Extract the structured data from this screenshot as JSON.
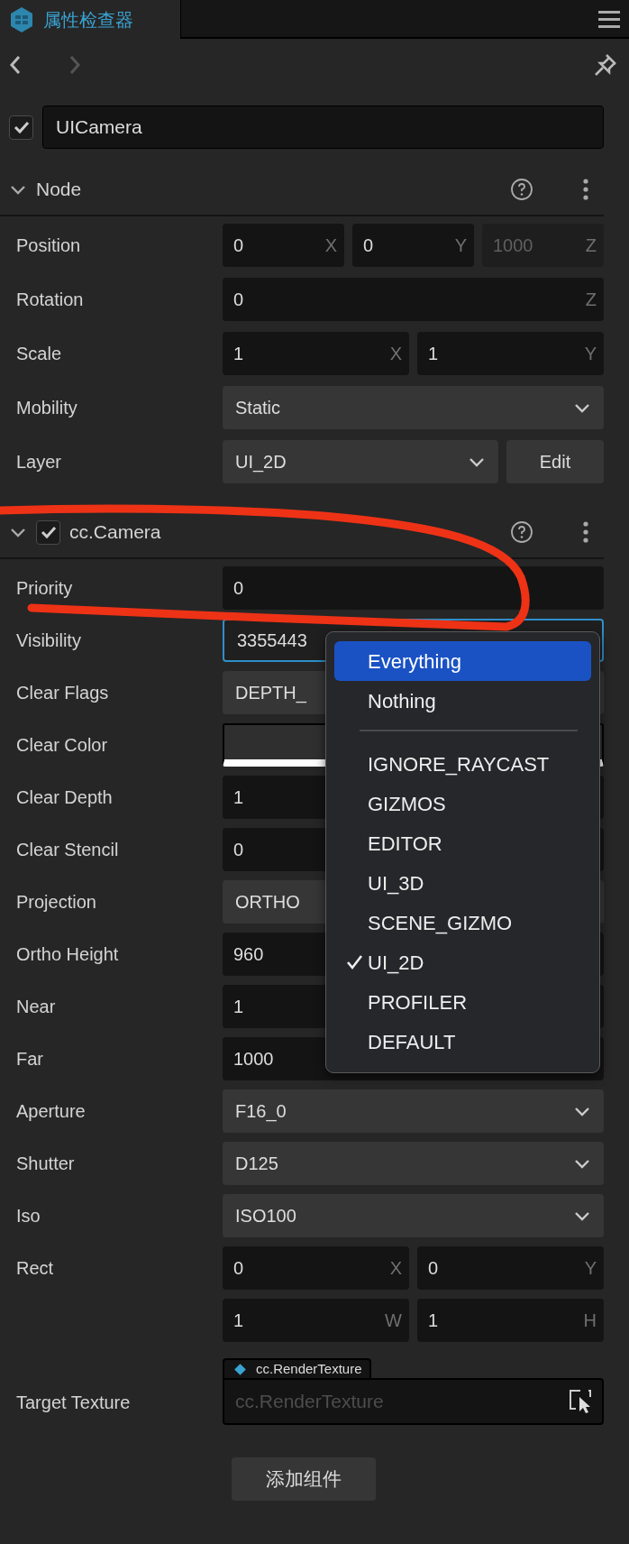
{
  "panel": {
    "title": "属性检查器"
  },
  "node_name": {
    "enabled": true,
    "value": "UICamera"
  },
  "sections": [
    {
      "title": "Node",
      "rows": [
        {
          "kind": "vector",
          "label": "Position",
          "fields": [
            {
              "value": "0",
              "axis": "X",
              "disabled": false
            },
            {
              "value": "0",
              "axis": "Y",
              "disabled": false
            },
            {
              "value": "1000",
              "axis": "Z",
              "disabled": true
            }
          ]
        },
        {
          "kind": "vector",
          "label": "Rotation",
          "fields": [
            {
              "value": "0",
              "axis": "Z",
              "disabled": false
            }
          ]
        },
        {
          "kind": "vector",
          "label": "Scale",
          "fields": [
            {
              "value": "1",
              "axis": "X",
              "disabled": false
            },
            {
              "value": "1",
              "axis": "Y",
              "disabled": false
            }
          ]
        },
        {
          "kind": "dropdown",
          "label": "Mobility",
          "value": "Static"
        },
        {
          "kind": "dropdown",
          "label": "Layer",
          "value": "UI_2D",
          "button": "Edit"
        }
      ]
    },
    {
      "title": "cc.Camera",
      "enabled": true,
      "rows": [
        {
          "kind": "number",
          "label": "Priority",
          "value": "0"
        },
        {
          "kind": "dropdown",
          "label": "Visibility",
          "value": "3355443",
          "focused": true
        },
        {
          "kind": "dropdown",
          "label": "Clear Flags",
          "value": "DEPTH_"
        },
        {
          "kind": "color",
          "label": "Clear Color"
        },
        {
          "kind": "number",
          "label": "Clear Depth",
          "value": "1"
        },
        {
          "kind": "number",
          "label": "Clear Stencil",
          "value": "0"
        },
        {
          "kind": "dropdown",
          "label": "Projection",
          "value": "ORTHO"
        },
        {
          "kind": "number",
          "label": "Ortho Height",
          "value": "960"
        },
        {
          "kind": "number",
          "label": "Near",
          "value": "1"
        },
        {
          "kind": "number",
          "label": "Far",
          "value": "1000"
        },
        {
          "kind": "dropdown",
          "label": "Aperture",
          "value": "F16_0"
        },
        {
          "kind": "dropdown",
          "label": "Shutter",
          "value": "D125"
        },
        {
          "kind": "dropdown",
          "label": "Iso",
          "value": "ISO100"
        },
        {
          "kind": "vector",
          "label": "Rect",
          "fields": [
            {
              "value": "0",
              "axis": "X",
              "disabled": false
            },
            {
              "value": "0",
              "axis": "Y",
              "disabled": false
            }
          ]
        },
        {
          "kind": "vector",
          "fields": [
            {
              "value": "1",
              "axis": "W",
              "disabled": false
            },
            {
              "value": "1",
              "axis": "H",
              "disabled": false
            }
          ]
        },
        {
          "kind": "asset",
          "label": "Target Texture",
          "tag": "cc.RenderTexture",
          "placeholder": "cc.RenderTexture"
        }
      ]
    }
  ],
  "add_button": "添加组件",
  "popup": {
    "items": [
      {
        "kind": "item",
        "label": "Everything",
        "selected": true,
        "checked": false
      },
      {
        "kind": "item",
        "label": "Nothing",
        "selected": false,
        "checked": false
      },
      {
        "kind": "separator"
      },
      {
        "kind": "item",
        "label": "IGNORE_RAYCAST",
        "selected": false,
        "checked": false
      },
      {
        "kind": "item",
        "label": "GIZMOS",
        "selected": false,
        "checked": false
      },
      {
        "kind": "item",
        "label": "EDITOR",
        "selected": false,
        "checked": false
      },
      {
        "kind": "item",
        "label": "UI_3D",
        "selected": false,
        "checked": false
      },
      {
        "kind": "item",
        "label": "SCENE_GIZMO",
        "selected": false,
        "checked": false
      },
      {
        "kind": "item",
        "label": "UI_2D",
        "selected": false,
        "checked": true
      },
      {
        "kind": "item",
        "label": "PROFILER",
        "selected": false,
        "checked": false
      },
      {
        "kind": "item",
        "label": "DEFAULT",
        "selected": false,
        "checked": false
      }
    ]
  }
}
